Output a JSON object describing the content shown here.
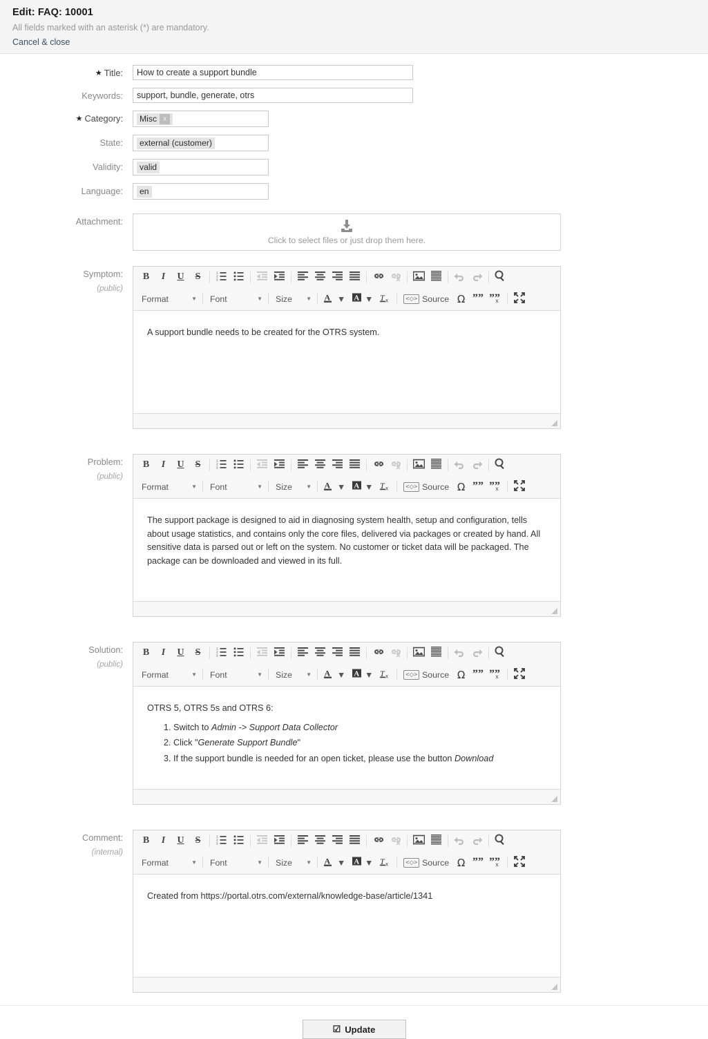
{
  "header": {
    "title": "Edit: FAQ: 10001",
    "mandatory_note": "All fields marked with an asterisk (*) are mandatory.",
    "cancel_label": "Cancel & close"
  },
  "fields": {
    "title": {
      "label": "Title:",
      "value": "How to create a support bundle",
      "required": true
    },
    "keywords": {
      "label": "Keywords:",
      "value": "support, bundle, generate, otrs",
      "required": false
    },
    "category": {
      "label": "Category:",
      "chip": "Misc",
      "remove": "x",
      "required": true
    },
    "state": {
      "label": "State:",
      "chip": "external (customer)",
      "required": false
    },
    "validity": {
      "label": "Validity:",
      "chip": "valid",
      "required": false
    },
    "language": {
      "label": "Language:",
      "chip": "en",
      "required": false
    },
    "attachment": {
      "label": "Attachment:",
      "dropzone_text": "Click to select files or just drop them here.",
      "icon": "download-icon"
    }
  },
  "toolbar": {
    "bold": "B",
    "italic": "I",
    "underline": "U",
    "strike": "S",
    "numbered_list": "numbered-list-icon",
    "bulleted_list": "bulleted-list-icon",
    "outdent": "outdent-icon",
    "indent": "indent-icon",
    "align_left": "align-left-icon",
    "align_center": "align-center-icon",
    "align_right": "align-right-icon",
    "align_justify": "align-justify-icon",
    "link": "link-icon",
    "unlink": "unlink-icon",
    "image": "image-icon",
    "horizontal_rule": "horizontal-rule-icon",
    "undo": "undo-icon",
    "redo": "redo-icon",
    "find": "search-icon",
    "format": "Format",
    "font": "Font",
    "size": "Size",
    "text_color": "A",
    "bg_color": "A",
    "remove_format": "Tx",
    "source": "Source",
    "special_char": "Ω",
    "quote_open": "quote-open-icon",
    "quote_remove": "quote-remove-icon",
    "maximize": "maximize-icon",
    "caret": "▾"
  },
  "sections": {
    "symptom": {
      "label": "Symptom:",
      "visibility": "(public)",
      "paragraphs": [
        "A support bundle needs to be created for the OTRS system."
      ]
    },
    "problem": {
      "label": "Problem:",
      "visibility": "(public)",
      "paragraphs": [
        "The support package is designed to aid in diagnosing system health, setup and configuration, tells about usage statistics, and contains only the core files, delivered via packages or created by hand. All sensitive data is parsed out or left on the system. No customer or ticket data will be packaged. The package can be downloaded and viewed in its full."
      ]
    },
    "solution": {
      "label": "Solution:",
      "visibility": "(public)",
      "intro": "OTRS 5, OTRS 5s and OTRS 6:",
      "steps": [
        "Switch to Admin -> Support Data Collector",
        "Click \"Generate Support Bundle\"",
        "If the support bundle is needed for an open ticket, please use the button Download"
      ],
      "steps_html": [
        "Switch to <em>Admin -&gt; Support Data Collector</em>",
        "Click \"<em>Generate Support Bundle</em>\"",
        "If the support bundle is needed for an open ticket, please use the button <em>Download</em>"
      ]
    },
    "comment": {
      "label": "Comment:",
      "visibility": "(internal)",
      "paragraphs": [
        "Created from https://portal.otrs.com/external/knowledge-base/article/1341"
      ]
    }
  },
  "footer": {
    "update_label": "Update",
    "update_icon": "☑"
  },
  "colors": {
    "header_bg": "#f4f4f4",
    "link": "#36526b",
    "toolbar_bg": "#f7f7f7",
    "border": "#d3d3d3",
    "chip_bg": "#e4e4e4"
  }
}
